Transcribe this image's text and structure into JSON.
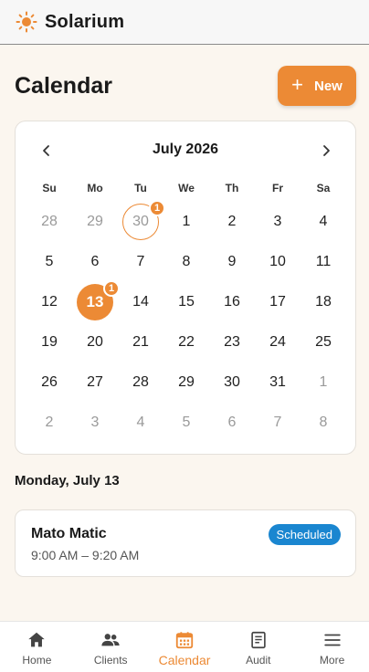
{
  "app": {
    "title": "Solarium"
  },
  "header": {
    "title": "Calendar",
    "new_label": "New"
  },
  "calendar": {
    "month_label": "July 2026",
    "days_of_week": [
      "Su",
      "Mo",
      "Tu",
      "We",
      "Th",
      "Fr",
      "Sa"
    ],
    "weeks": [
      [
        {
          "d": "28",
          "m": true
        },
        {
          "d": "29",
          "m": true
        },
        {
          "d": "30",
          "m": true,
          "today": true,
          "badge": "1"
        },
        {
          "d": "1"
        },
        {
          "d": "2"
        },
        {
          "d": "3"
        },
        {
          "d": "4"
        }
      ],
      [
        {
          "d": "5"
        },
        {
          "d": "6"
        },
        {
          "d": "7"
        },
        {
          "d": "8"
        },
        {
          "d": "9"
        },
        {
          "d": "10"
        },
        {
          "d": "11"
        }
      ],
      [
        {
          "d": "12"
        },
        {
          "d": "13",
          "selected": true,
          "badge": "1"
        },
        {
          "d": "14"
        },
        {
          "d": "15"
        },
        {
          "d": "16"
        },
        {
          "d": "17"
        },
        {
          "d": "18"
        }
      ],
      [
        {
          "d": "19"
        },
        {
          "d": "20"
        },
        {
          "d": "21"
        },
        {
          "d": "22"
        },
        {
          "d": "23"
        },
        {
          "d": "24"
        },
        {
          "d": "25"
        }
      ],
      [
        {
          "d": "26"
        },
        {
          "d": "27"
        },
        {
          "d": "28"
        },
        {
          "d": "29"
        },
        {
          "d": "30"
        },
        {
          "d": "31"
        },
        {
          "d": "1",
          "m": true
        }
      ],
      [
        {
          "d": "2",
          "m": true
        },
        {
          "d": "3",
          "m": true
        },
        {
          "d": "4",
          "m": true
        },
        {
          "d": "5",
          "m": true
        },
        {
          "d": "6",
          "m": true
        },
        {
          "d": "7",
          "m": true
        },
        {
          "d": "8",
          "m": true
        }
      ]
    ]
  },
  "selected_date": {
    "label": "Monday, July 13"
  },
  "appointments": [
    {
      "name": "Mato Matic",
      "time": "9:00 AM – 9:20 AM",
      "status": "Scheduled"
    }
  ],
  "nav": {
    "items": [
      {
        "label": "Home",
        "icon": "home-icon"
      },
      {
        "label": "Clients",
        "icon": "people-icon"
      },
      {
        "label": "Calendar",
        "icon": "calendar-icon",
        "active": true
      },
      {
        "label": "Audit",
        "icon": "clipboard-icon"
      },
      {
        "label": "More",
        "icon": "menu-icon"
      }
    ]
  },
  "colors": {
    "accent": "#ec8a35",
    "status_scheduled": "#1a86d0",
    "background": "#fbf6ef"
  }
}
